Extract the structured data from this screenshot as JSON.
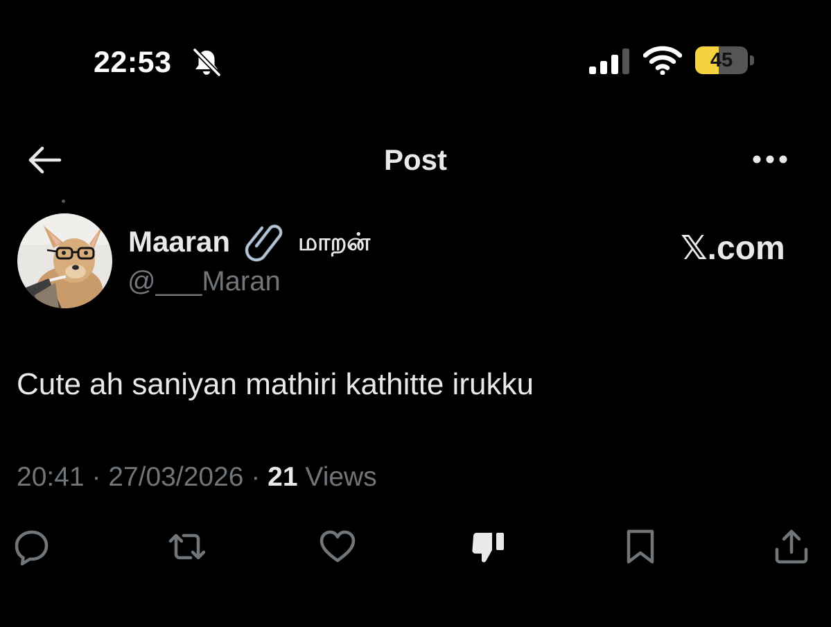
{
  "status_bar": {
    "time": "22:53",
    "battery_percent": "45",
    "battery_level": 0.45
  },
  "header": {
    "title": "Post"
  },
  "author": {
    "display_name": "Maaran",
    "tamil_name": "மாறன்",
    "handle": "@___Maran"
  },
  "source_label": "𝕏.com",
  "post": {
    "text": "Cute ah saniyan mathiri kathitte irukku"
  },
  "meta": {
    "time": "20:41",
    "date": "27/03/2026",
    "separator": " · ",
    "views_count": "21",
    "views_label": "Views"
  },
  "actions": [
    "reply-icon",
    "repost-icon",
    "like-icon",
    "dislike-icon",
    "bookmark-icon",
    "share-icon"
  ],
  "colors": {
    "background": "#000000",
    "text": "#e7e9ea",
    "secondary": "#71767b",
    "battery": "#f6d33e"
  }
}
